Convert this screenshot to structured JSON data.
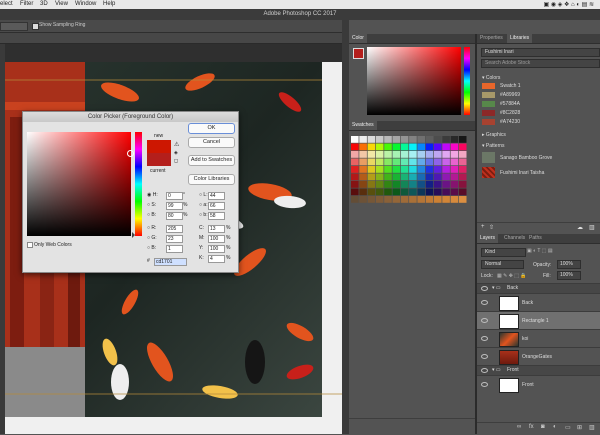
{
  "menubar": {
    "items": [
      "elect",
      "Filter",
      "3D",
      "View",
      "Window",
      "Help"
    ]
  },
  "app": {
    "title": "Adobe Photoshop CC 2017"
  },
  "options": {
    "sampling_ring": "Show Sampling Ring"
  },
  "colors": {
    "accent": "#b41f1c",
    "panel": "#535353"
  },
  "color_panel": {
    "tab": "Color"
  },
  "swatches_panel": {
    "tab": "Swatches"
  },
  "libraries": {
    "tabs": [
      "Properties",
      "Libraries"
    ],
    "library_name": "Fushimi Inari",
    "search_placeholder": "Search Adobe Stock",
    "colors_header": "Colors",
    "colors": [
      {
        "label": "Swatch 1",
        "hex": "#e8662b"
      },
      {
        "label": "#A89969",
        "hex": "#a89969"
      },
      {
        "label": "#57884A",
        "hex": "#57884a"
      },
      {
        "label": "#8C2828",
        "hex": "#8c2828"
      },
      {
        "label": "#A74230",
        "hex": "#a74230"
      }
    ],
    "graphics_header": "Graphics",
    "patterns_header": "Patterns",
    "patterns": [
      "Sanago Bamboo Grove",
      "Fushimi Inari Taisha"
    ]
  },
  "layers": {
    "tabs": [
      "Layers",
      "Channels",
      "Paths"
    ],
    "kind": "Kind",
    "blend": "Normal",
    "opacity_label": "Opacity:",
    "opacity": "100%",
    "lock_label": "Lock:",
    "fill_label": "Fill:",
    "fill": "100%",
    "rows": [
      {
        "name": "Back",
        "type": "group"
      },
      {
        "name": "Back",
        "type": "layer"
      },
      {
        "name": "Rectangle 1",
        "type": "layer"
      },
      {
        "name": "koi",
        "type": "layer"
      },
      {
        "name": "OrangeGates",
        "type": "layer"
      },
      {
        "name": "Front",
        "type": "group"
      },
      {
        "name": "Front",
        "type": "layer"
      }
    ]
  },
  "dialog": {
    "title": "Color Picker (Foreground Color)",
    "ok": "OK",
    "cancel": "Cancel",
    "add_to_swatches": "Add to Swatches",
    "color_libraries": "Color Libraries",
    "new_label": "new",
    "current_label": "current",
    "only_web": "Only Web Colors",
    "hex": "cd1701",
    "fields": {
      "H": "0",
      "S": "99",
      "B": "80",
      "R": "205",
      "G": "23",
      "B2": "1",
      "L": "44",
      "a": "66",
      "b": "58",
      "C": "13",
      "M": "100",
      "Y": "100",
      "K": "4"
    },
    "units": {
      "H": "°",
      "S": "%",
      "B": "%",
      "C": "%",
      "M": "%",
      "Y": "%",
      "K": "%"
    }
  }
}
